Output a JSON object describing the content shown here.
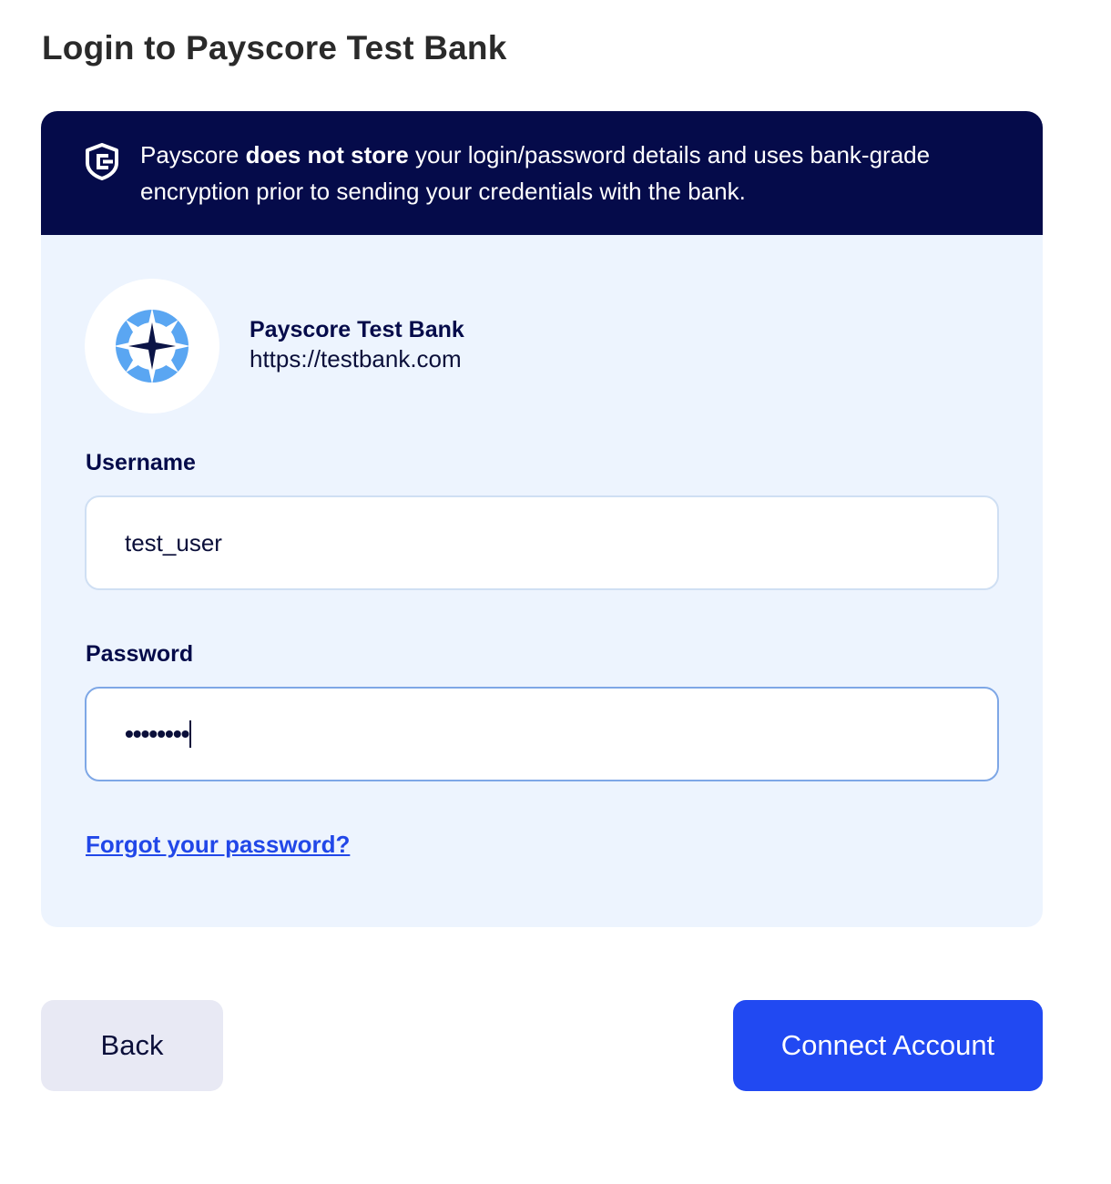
{
  "page": {
    "title": "Login to Payscore Test Bank"
  },
  "notice": {
    "icon": "payscore-shield-icon",
    "text_prefix": "Payscore ",
    "text_bold": "does not store",
    "text_suffix": " your login/password details and uses bank-grade encryption prior to sending your credentials with the bank."
  },
  "bank": {
    "logo_icon": "compass-star-icon",
    "name": "Payscore Test Bank",
    "url": "https://testbank.com"
  },
  "form": {
    "username_label": "Username",
    "username_value": "test_user",
    "password_label": "Password",
    "password_value": "••••••••",
    "forgot_link": "Forgot your password?"
  },
  "actions": {
    "back_label": "Back",
    "connect_label": "Connect Account"
  },
  "colors": {
    "notice_bg": "#050b4a",
    "card_bg": "#edf4fe",
    "primary": "#2149f2",
    "link": "#2147e8",
    "back_bg": "#e8e9f4",
    "logo_light": "#5aa6f2",
    "logo_dark": "#0b1446"
  }
}
